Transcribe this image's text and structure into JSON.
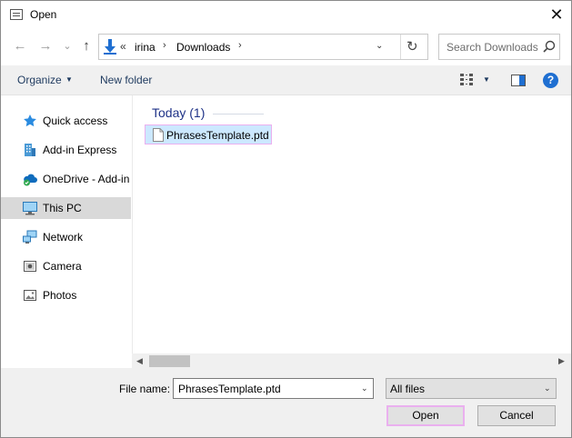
{
  "window": {
    "title": "Open",
    "close_glyph": "✕"
  },
  "nav": {
    "back_glyph": "←",
    "forward_glyph": "→",
    "recent_glyph": "⌄",
    "up_glyph": "↑",
    "address": {
      "overflow": "«",
      "segments": [
        "irina",
        "Downloads"
      ],
      "separator": "›",
      "dropdown_glyph": "⌄",
      "refresh_glyph": "↻"
    },
    "search": {
      "placeholder": "Search Downloads"
    }
  },
  "toolbar": {
    "organize_label": "Organize",
    "caret_glyph": "▼",
    "new_folder_label": "New folder",
    "help_glyph": "?"
  },
  "sidebar": {
    "items": [
      {
        "label": "Quick access",
        "icon": "star-icon",
        "selected": false
      },
      {
        "label": "Add-in Express",
        "icon": "building-icon",
        "selected": false
      },
      {
        "label": "OneDrive - Add-in",
        "icon": "cloud-icon",
        "selected": false
      },
      {
        "label": "This PC",
        "icon": "computer-icon",
        "selected": true
      },
      {
        "label": "Network",
        "icon": "network-icon",
        "selected": false
      },
      {
        "label": "Camera",
        "icon": "camera-icon",
        "selected": false
      },
      {
        "label": "Photos",
        "icon": "photos-icon",
        "selected": false
      }
    ]
  },
  "content": {
    "group_label": "Today (1)",
    "files": [
      {
        "name": "PhrasesTemplate.ptd",
        "selected": true
      }
    ]
  },
  "scrollbar": {
    "left_glyph": "◀",
    "right_glyph": "▶"
  },
  "footer": {
    "filename_label": "File name:",
    "filename_value": "PhrasesTemplate.ptd",
    "filetype_value": "All files",
    "dropdown_glyph": "⌄",
    "open_label": "Open",
    "cancel_label": "Cancel"
  },
  "colors": {
    "accent": "#1f6fd1",
    "selection_fill": "#cce8ff",
    "focus_outline": "#eab0ef",
    "group_text": "#1e3287"
  }
}
